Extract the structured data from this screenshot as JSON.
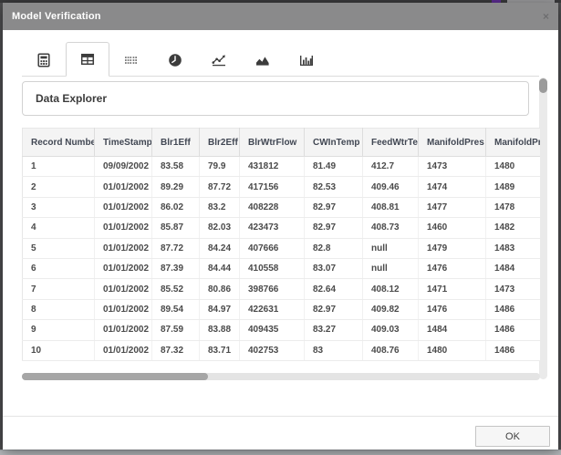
{
  "window": {
    "title": "Model Verification",
    "close_icon": "×"
  },
  "tabs": [
    {
      "icon": "calculator-icon",
      "active": false
    },
    {
      "icon": "data-table-icon",
      "active": true
    },
    {
      "icon": "grid-dots-icon",
      "active": false
    },
    {
      "icon": "clock-icon",
      "active": false
    },
    {
      "icon": "line-chart-icon",
      "active": false
    },
    {
      "icon": "area-chart-icon",
      "active": false
    },
    {
      "icon": "bar-chart-icon",
      "active": false
    }
  ],
  "explorer": {
    "title": "Data Explorer"
  },
  "table": {
    "columns": [
      "Record Number",
      "TimeStamp",
      "Blr1Eff",
      "Blr2Eff",
      "BlrWtrFlow",
      "CWInTemp",
      "FeedWtrTemp",
      "ManifoldPres",
      "ManifoldPres"
    ],
    "rows": [
      [
        "1",
        "09/09/2002",
        "83.58",
        "79.9",
        "431812",
        "81.49",
        "412.7",
        "1473",
        "1480"
      ],
      [
        "2",
        "01/01/2002",
        "89.29",
        "87.72",
        "417156",
        "82.53",
        "409.46",
        "1474",
        "1489"
      ],
      [
        "3",
        "01/01/2002",
        "86.02",
        "83.2",
        "408228",
        "82.97",
        "408.81",
        "1477",
        "1478"
      ],
      [
        "4",
        "01/01/2002",
        "85.87",
        "82.03",
        "423473",
        "82.97",
        "408.73",
        "1460",
        "1482"
      ],
      [
        "5",
        "01/01/2002",
        "87.72",
        "84.24",
        "407666",
        "82.8",
        "null",
        "1479",
        "1483"
      ],
      [
        "6",
        "01/01/2002",
        "87.39",
        "84.44",
        "410558",
        "83.07",
        "null",
        "1476",
        "1484"
      ],
      [
        "7",
        "01/01/2002",
        "85.52",
        "80.86",
        "398766",
        "82.64",
        "408.12",
        "1471",
        "1473"
      ],
      [
        "8",
        "01/01/2002",
        "89.54",
        "84.97",
        "422631",
        "82.97",
        "409.82",
        "1476",
        "1486"
      ],
      [
        "9",
        "01/01/2002",
        "87.59",
        "83.88",
        "409435",
        "83.27",
        "409.03",
        "1484",
        "1486"
      ],
      [
        "10",
        "01/01/2002",
        "87.32",
        "83.71",
        "402753",
        "83",
        "408.76",
        "1480",
        "1486"
      ]
    ]
  },
  "footer": {
    "ok_label": "OK"
  },
  "colors": {
    "titlebar_gray": "#8a8a8b",
    "accent_purple": "#5c2d91",
    "table_header_bg": "#f4f4f4",
    "table_header_text": "#414753",
    "cell_text": "#4a4a4a"
  }
}
